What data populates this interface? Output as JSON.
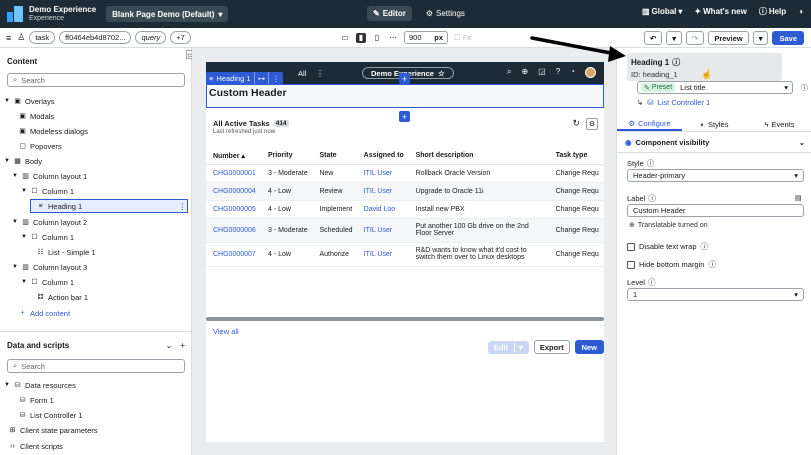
{
  "topbar": {
    "app_title": "Demo Experience",
    "app_subtitle": "Experience",
    "page_select": "Blank Page Demo (Default)",
    "mode_editor": "Editor",
    "mode_settings": "Settings",
    "global": "Global",
    "whats_new": "What's new",
    "help": "Help"
  },
  "toolbar": {
    "chip_task": "task",
    "chip_sysid": "ff0464eb4d8702...",
    "chip_query": "query",
    "chip_more": "+7",
    "width_value": "900",
    "width_unit": "px",
    "fit": "Fit",
    "preview": "Preview",
    "save": "Save"
  },
  "left": {
    "content_title": "Content",
    "search_placeholder": "Search",
    "tree": [
      {
        "label": "Overlays"
      },
      {
        "label": "Modals"
      },
      {
        "label": "Modeless dialogs"
      },
      {
        "label": "Popovers"
      },
      {
        "label": "Body"
      },
      {
        "label": "Column layout 1"
      },
      {
        "label": "Column 1"
      },
      {
        "label": "Heading 1"
      },
      {
        "label": "Column layout 2"
      },
      {
        "label": "Column 1"
      },
      {
        "label": "List - Simple 1"
      },
      {
        "label": "Column layout 3"
      },
      {
        "label": "Column 1"
      },
      {
        "label": "Action bar 1"
      },
      {
        "label": "Add content"
      }
    ],
    "data_title": "Data and scripts",
    "data_search_placeholder": "Search",
    "data_tree": [
      {
        "label": "Data resources"
      },
      {
        "label": "Form 1"
      },
      {
        "label": "List Controller 1"
      },
      {
        "label": "Client state parameters"
      },
      {
        "label": "Client scripts"
      }
    ]
  },
  "canvas": {
    "nav_all": "All",
    "nav_experience": "Demo Experience",
    "heading_tag": "Heading 1",
    "custom_header": "Custom Header",
    "list_title": "All Active Tasks",
    "list_count": "414",
    "last_refreshed": "Last refreshed just now",
    "columns": [
      "Number",
      "Priority",
      "State",
      "Assigned to",
      "Short description",
      "Task type"
    ],
    "rows": [
      [
        "CHG0000001",
        "3 - Moderate",
        "New",
        "ITIL User",
        "Rollback Oracle Version",
        "Change Requ"
      ],
      [
        "CHG0000004",
        "4 - Low",
        "Review",
        "ITIL User",
        "Upgrade to Oracle 11i",
        "Change Requ"
      ],
      [
        "CHG0000005",
        "4 - Low",
        "Implement",
        "David Loo",
        "Install new PBX",
        "Change Requ"
      ],
      [
        "CHG0000006",
        "3 - Moderate",
        "Scheduled",
        "ITIL User",
        "Put another 100 Gb drive on the 2nd Floor Server",
        "Change Requ"
      ],
      [
        "CHG0000007",
        "4 - Low",
        "Authorize",
        "ITIL User",
        "R&D wants to know what it'd cost to switch them over to Linux desktops",
        "Change Requ"
      ]
    ],
    "view_all": "View all",
    "btn_edit": "Edit",
    "btn_export": "Export",
    "btn_new": "New"
  },
  "right": {
    "pop_title": "Heading 1",
    "pop_id": "ID: heading_1",
    "preset_tag": "Preset",
    "preset_value": "List title",
    "list_controller": "List Controller 1",
    "tab_configure": "Configure",
    "tab_styles": "Styles",
    "tab_events": "Events",
    "component_visibility": "Component visibility",
    "style_label": "Style",
    "style_value": "Header-primary",
    "label_label": "Label",
    "label_value": "Custom Header",
    "translatable": "Translatable turned on",
    "disable_wrap": "Disable text wrap",
    "hide_margin": "Hide bottom margin",
    "level_label": "Level",
    "level_value": "1"
  },
  "colors": {
    "topbar": "#1c2b36",
    "accent": "#2d5bd4",
    "canvas_bg": "#eaecee"
  }
}
